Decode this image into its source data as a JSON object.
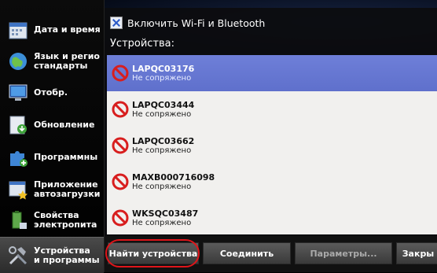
{
  "sidebar": {
    "items": [
      {
        "label": "Дата и время",
        "icon": "calendar-icon"
      },
      {
        "label": "Язык и регио\nстандарты",
        "icon": "globe-icon"
      },
      {
        "label": "Отобр.",
        "icon": "display-icon"
      },
      {
        "label": "Обновление",
        "icon": "update-icon"
      },
      {
        "label": "Программны",
        "icon": "puzzle-icon"
      },
      {
        "label": "Приложение\nавтозагрузки",
        "icon": "startup-app-icon"
      },
      {
        "label": "Свойства\nэлектропита",
        "icon": "power-icon"
      },
      {
        "label": "Устройства\nи программы",
        "icon": "devices-icon"
      }
    ]
  },
  "dialog": {
    "toggle_label": "Включить Wi-Fi и Bluetooth",
    "devices_label": "Устройства:",
    "devices": [
      {
        "name": "LAPQC03176",
        "status": "Не сопряжено",
        "selected": true
      },
      {
        "name": "LAPQC03444",
        "status": "Не сопряжено",
        "selected": false
      },
      {
        "name": "LAPQC03662",
        "status": "Не сопряжено",
        "selected": false
      },
      {
        "name": "MAXB000716098",
        "status": "Не сопряжено",
        "selected": false
      },
      {
        "name": "WKSQC03487",
        "status": "Не сопряжено",
        "selected": false
      }
    ]
  },
  "buttons": {
    "find": "Найти устройства",
    "connect": "Соединить",
    "params": "Параметры...",
    "close": "Закры"
  },
  "colors": {
    "selected_row": "#6272d0",
    "highlight_oval": "#e0151a",
    "blocked_icon": "#d81e1e"
  }
}
